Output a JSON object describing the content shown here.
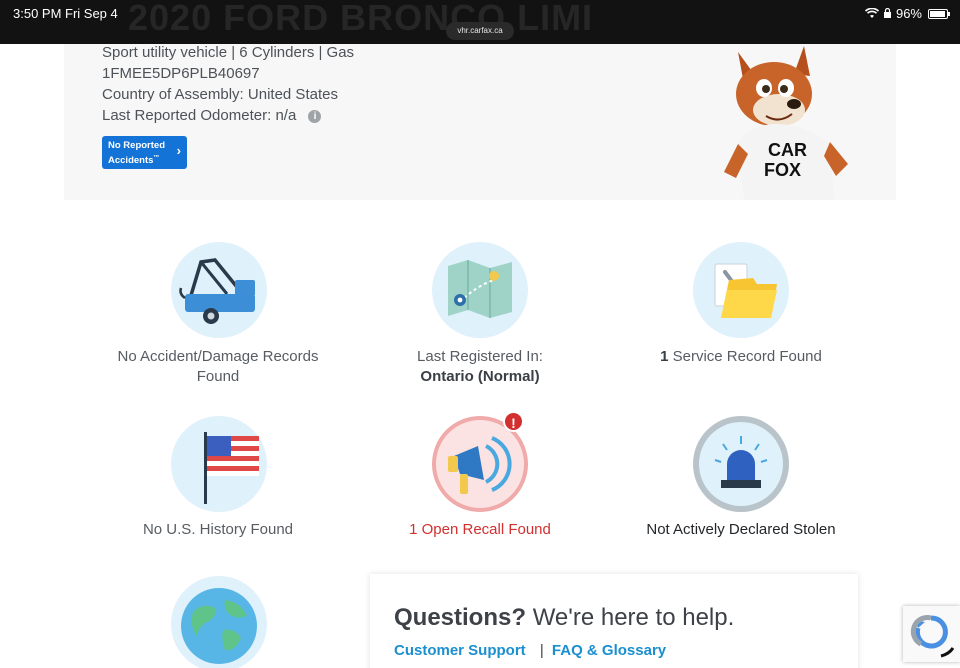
{
  "statusbar": {
    "time": "3:50 PM",
    "date": "Fri Sep 4",
    "battery": "96%",
    "url": "vhr.carfax.ca",
    "ghost_title": "2020 FORD BRONCO LIMI"
  },
  "vehicle": {
    "line1": "Sport utility vehicle | 6 Cylinders | Gas",
    "vin": "1FMEE5DP6PLB40697",
    "assembly_label": "Country of Assembly:",
    "assembly_value": "United States",
    "odometer_label": "Last Reported Odometer:",
    "odometer_value": "n/a",
    "info_icon": "i",
    "accident_btn_line1": "No Reported",
    "accident_btn_line2": "Accidents",
    "accident_btn_tm": "™",
    "mascot_shirt_line1": "CAR",
    "mascot_shirt_line2": "FOX"
  },
  "tiles": {
    "accident": {
      "line1": "No Accident/Damage Records",
      "line2": "Found"
    },
    "registered": {
      "line1": "Last Registered In:",
      "line2": "Ontario (Normal)"
    },
    "service": {
      "count": "1",
      "text": "Service Record Found"
    },
    "us_history": {
      "text": "No U.S. History Found"
    },
    "recall": {
      "text": "1 Open Recall Found",
      "badge": "!"
    },
    "stolen": {
      "text": "Not Actively Declared Stolen"
    }
  },
  "questions": {
    "title_bold": "Questions?",
    "title_rest": "We're here to help.",
    "link_support": "Customer Support",
    "separator": "|",
    "link_faq": "FAQ & Glossary"
  },
  "colors": {
    "accent_blue": "#1473d6",
    "link_blue": "#1b8fcf",
    "alert_red": "#d32f2f",
    "tile_circle": "#dff1fb"
  }
}
